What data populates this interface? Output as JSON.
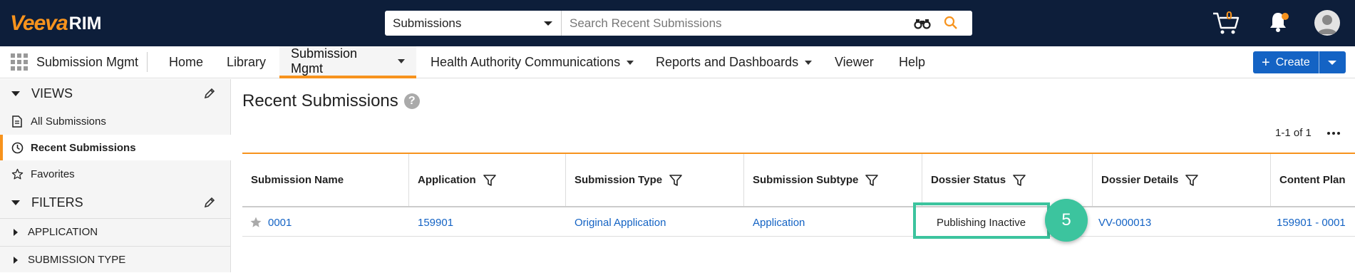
{
  "brand": {
    "logo_veeva": "Veeva",
    "logo_rim": "RIM",
    "accent": "#f7931d",
    "header_bg": "#0d1e3a",
    "link_color": "#1463c4",
    "highlight": "#3cc49e"
  },
  "search": {
    "scope": "Submissions",
    "placeholder": "Search Recent Submissions"
  },
  "header": {
    "cart_count": "0"
  },
  "nav": {
    "app_label": "Submission Mgmt",
    "items": [
      {
        "label": "Home"
      },
      {
        "label": "Library"
      },
      {
        "label": "Submission Mgmt"
      },
      {
        "label": "Health Authority Communications"
      },
      {
        "label": "Reports and Dashboards"
      },
      {
        "label": "Viewer"
      },
      {
        "label": "Help"
      }
    ],
    "create_label": "Create"
  },
  "sidebar": {
    "views_title": "VIEWS",
    "views": [
      {
        "label": "All Submissions",
        "icon": "document-icon"
      },
      {
        "label": "Recent Submissions",
        "icon": "clock-icon"
      },
      {
        "label": "Favorites",
        "icon": "star-icon"
      }
    ],
    "filters_title": "FILTERS",
    "filters": [
      {
        "label": "APPLICATION"
      },
      {
        "label": "SUBMISSION TYPE"
      }
    ]
  },
  "main": {
    "title": "Recent Submissions",
    "pager": "1-1 of 1",
    "columns": [
      "Submission Name",
      "Application",
      "Submission Type",
      "Submission Subtype",
      "Dossier Status",
      "Dossier Details",
      "Content Plan"
    ],
    "rows": [
      [
        "0001",
        "159901",
        "Original Application",
        "Application",
        "Publishing Inactive",
        "VV-000013",
        "159901 - 0001"
      ]
    ]
  },
  "callout": {
    "number": "5"
  }
}
